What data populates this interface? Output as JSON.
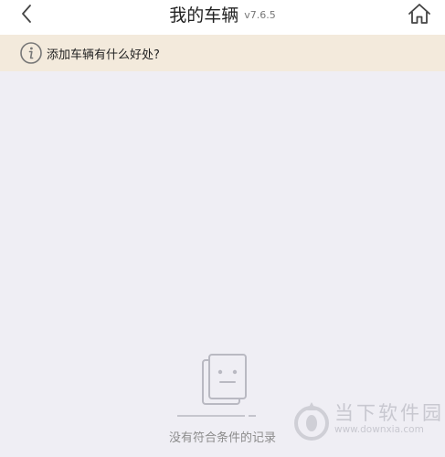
{
  "header": {
    "title": "我的车辆",
    "version": "v7.6.5",
    "back_icon": "chevron-left-icon",
    "home_icon": "home-icon"
  },
  "info_bar": {
    "text": "添加车辆有什么好处?",
    "icon": "info-icon"
  },
  "empty_state": {
    "message": "没有符合条件的记录",
    "icon": "empty-document-icon"
  },
  "watermark": {
    "brand": "当下软件园",
    "url": "www.downxia.com"
  }
}
